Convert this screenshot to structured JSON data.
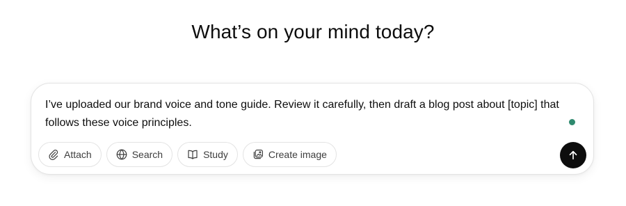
{
  "heading": "What’s on your mind today?",
  "composer": {
    "text": "I’ve uploaded our brand voice and tone guide. Review it carefully, then draft a blog post about [topic] that follows these voice principles.",
    "voice_indicator_color": "#2f8a6f",
    "tools": [
      {
        "label": "Attach",
        "icon": "paperclip-icon"
      },
      {
        "label": "Search",
        "icon": "globe-icon"
      },
      {
        "label": "Study",
        "icon": "book-icon"
      },
      {
        "label": "Create image",
        "icon": "image-icon"
      }
    ],
    "send_icon": "arrow-up-icon"
  }
}
